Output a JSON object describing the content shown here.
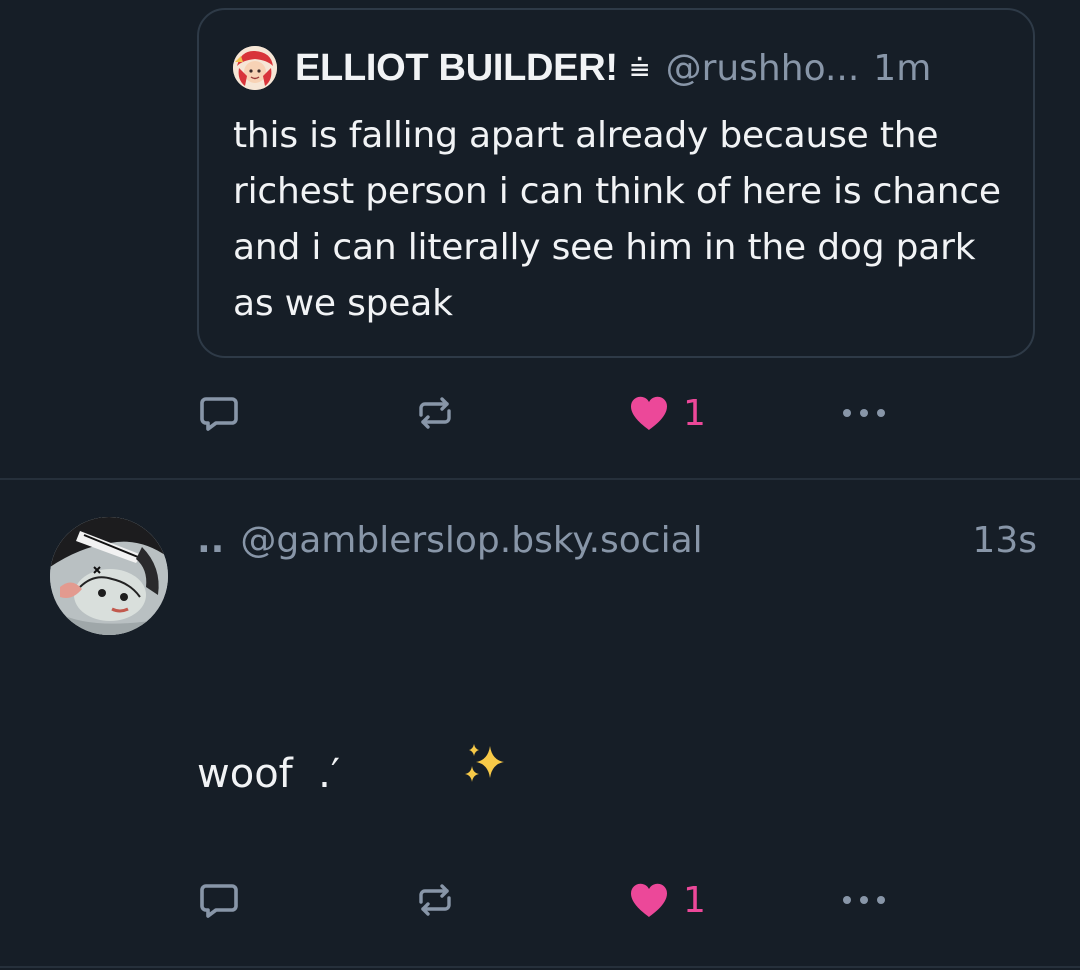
{
  "quoted_post": {
    "author_name": "ELLIOT BUILDER!",
    "name_glyph": "⩧",
    "handle": "@rushho...",
    "time": "1m",
    "text": "this is falling apart already because the richest person i can think of here is chance and i can literally see him in the dog park as we speak",
    "like_count": "1"
  },
  "post": {
    "author_name": "..",
    "handle": "@gamblerslop.bsky.social",
    "time": "13s",
    "text": "woof  .′",
    "like_count": "1"
  },
  "colors": {
    "background": "#161e27",
    "text": "#f1f3f5",
    "muted": "#8896a8",
    "like": "#ec4899",
    "border": "#2e3a47"
  },
  "icons": {
    "reply": "reply-icon",
    "repost": "repost-icon",
    "like": "heart-icon",
    "more": "more-icon",
    "sparkles": "sparkles-icon"
  }
}
